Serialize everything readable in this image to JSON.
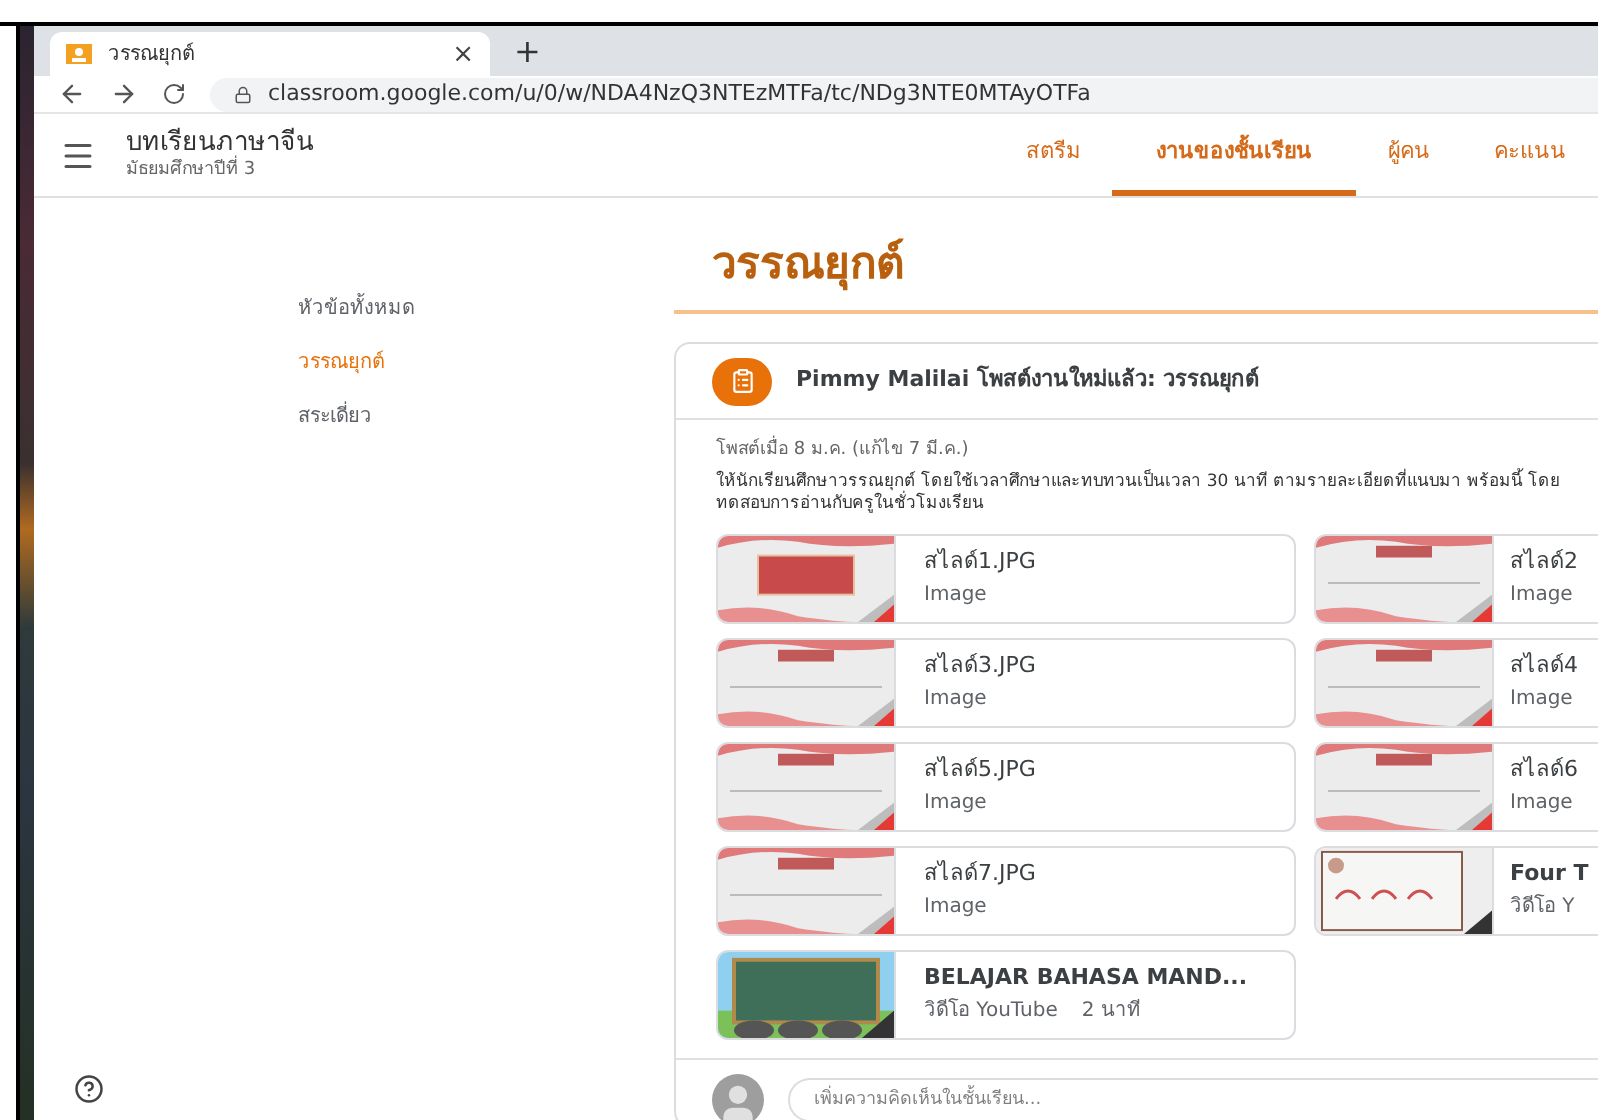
{
  "browser": {
    "tab_title": "วรรณยุกต์",
    "close": "×",
    "new_tab": "+",
    "url": "classroom.google.com/u/0/w/NDA4NzQ3NTEzMTFa/tc/NDg3NTE0MTAyOTFa"
  },
  "class": {
    "name": "บทเรียนภาษาจีน",
    "section": "มัธยมศึกษาปีที่ 3"
  },
  "nav_tabs": [
    {
      "label": "สตรีม",
      "selected": false
    },
    {
      "label": "งานของชั้นเรียน",
      "selected": true
    },
    {
      "label": "ผู้คน",
      "selected": false
    },
    {
      "label": "คะแนน",
      "selected": false
    }
  ],
  "topics": [
    {
      "label": "หัวข้อทั้งหมด",
      "selected": false
    },
    {
      "label": "วรรณยุกต์",
      "selected": true
    },
    {
      "label": "สระเดี่ยว",
      "selected": false
    }
  ],
  "topic_title": "วรรณยุกต์",
  "post": {
    "header": "Pimmy Malilai โพสต์งานใหม่แล้ว: วรรณยุกต์",
    "posted": "โพสต์เมื่อ 8 ม.ค. (แก้ไข 7 มี.ค.)",
    "body": "ให้นักเรียนศึกษาวรรณยุกต์ โดยใช้เวลาศึกษาและทบทวนเป็นเวลา 30 นาที ตามรายละเอียดที่แนบมา พร้อมนี้ โดยทดสอบการอ่านกับครูในชั่วโมงเรียน",
    "attachments": [
      {
        "title": "สไลด์1.JPG",
        "subtitle": "Image"
      },
      {
        "title": "สไลด์2",
        "subtitle": "Image"
      },
      {
        "title": "สไลด์3.JPG",
        "subtitle": "Image"
      },
      {
        "title": "สไลด์4",
        "subtitle": "Image"
      },
      {
        "title": "สไลด์5.JPG",
        "subtitle": "Image"
      },
      {
        "title": "สไลด์6",
        "subtitle": "Image"
      },
      {
        "title": "สไลด์7.JPG",
        "subtitle": "Image"
      },
      {
        "kind": "video",
        "title": "Four T",
        "subtitle": "วิดีโอ Y"
      },
      {
        "kind": "video",
        "title": "BELAJAR BAHASA MAND...",
        "subtitle": "วิดีโอ YouTube",
        "duration": "2 นาที"
      }
    ],
    "comment_placeholder": "เพิ่มความคิดเห็นในชั้นเรียน..."
  }
}
